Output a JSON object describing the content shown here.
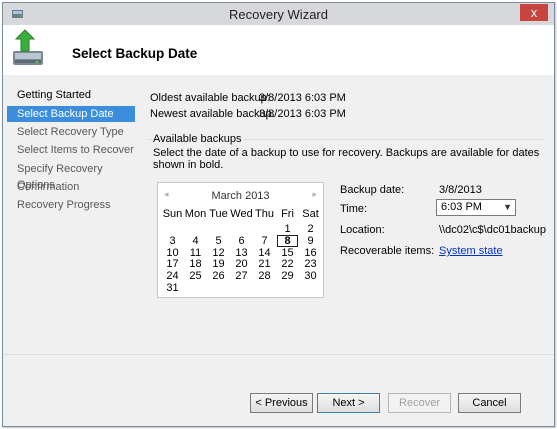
{
  "window": {
    "title": "Recovery Wizard",
    "close_glyph": "x"
  },
  "header": {
    "title": "Select Backup Date",
    "icon": "backup-restore-icon"
  },
  "sidebar": {
    "items": [
      {
        "label": "Getting Started"
      },
      {
        "label": "Select Backup Date"
      },
      {
        "label": "Select Recovery Type"
      },
      {
        "label": "Select Items to Recover"
      },
      {
        "label": "Specify Recovery Options"
      },
      {
        "label": "Confirmation"
      },
      {
        "label": "Recovery Progress"
      }
    ],
    "active_index": 1
  },
  "backups": {
    "oldest_label": "Oldest available backup:",
    "oldest_value": "3/8/2013 6:03 PM",
    "newest_label": "Newest available backup:",
    "newest_value": "3/8/2013 6:03 PM",
    "group_label": "Available backups",
    "instruction": "Select the date of a backup to use for recovery. Backups are available for dates shown in bold."
  },
  "calendar": {
    "month_label": "March 2013",
    "prev_glyph": "◂",
    "next_glyph": "▸",
    "days_of_week": [
      "Sun",
      "Mon",
      "Tue",
      "Wed",
      "Thu",
      "Fri",
      "Sat"
    ],
    "weeks": [
      [
        "",
        "",
        "",
        "",
        "",
        "1",
        "2"
      ],
      [
        "3",
        "4",
        "5",
        "6",
        "7",
        "8",
        "9"
      ],
      [
        "10",
        "11",
        "12",
        "13",
        "14",
        "15",
        "16"
      ],
      [
        "17",
        "18",
        "19",
        "20",
        "21",
        "22",
        "23"
      ],
      [
        "24",
        "25",
        "26",
        "27",
        "28",
        "29",
        "30"
      ],
      [
        "31",
        "",
        "",
        "",
        "",
        "",
        ""
      ]
    ],
    "selected_day": "8"
  },
  "details": {
    "backup_date_label": "Backup date:",
    "backup_date_value": "3/8/2013",
    "time_label": "Time:",
    "time_value": "6:03 PM",
    "location_label": "Location:",
    "location_value": "\\\\dc02\\c$\\dc01backup",
    "recoverable_label": "Recoverable items:",
    "recoverable_link": "System state"
  },
  "buttons": {
    "previous": "< Previous",
    "next": "Next >",
    "recover": "Recover",
    "cancel": "Cancel"
  }
}
